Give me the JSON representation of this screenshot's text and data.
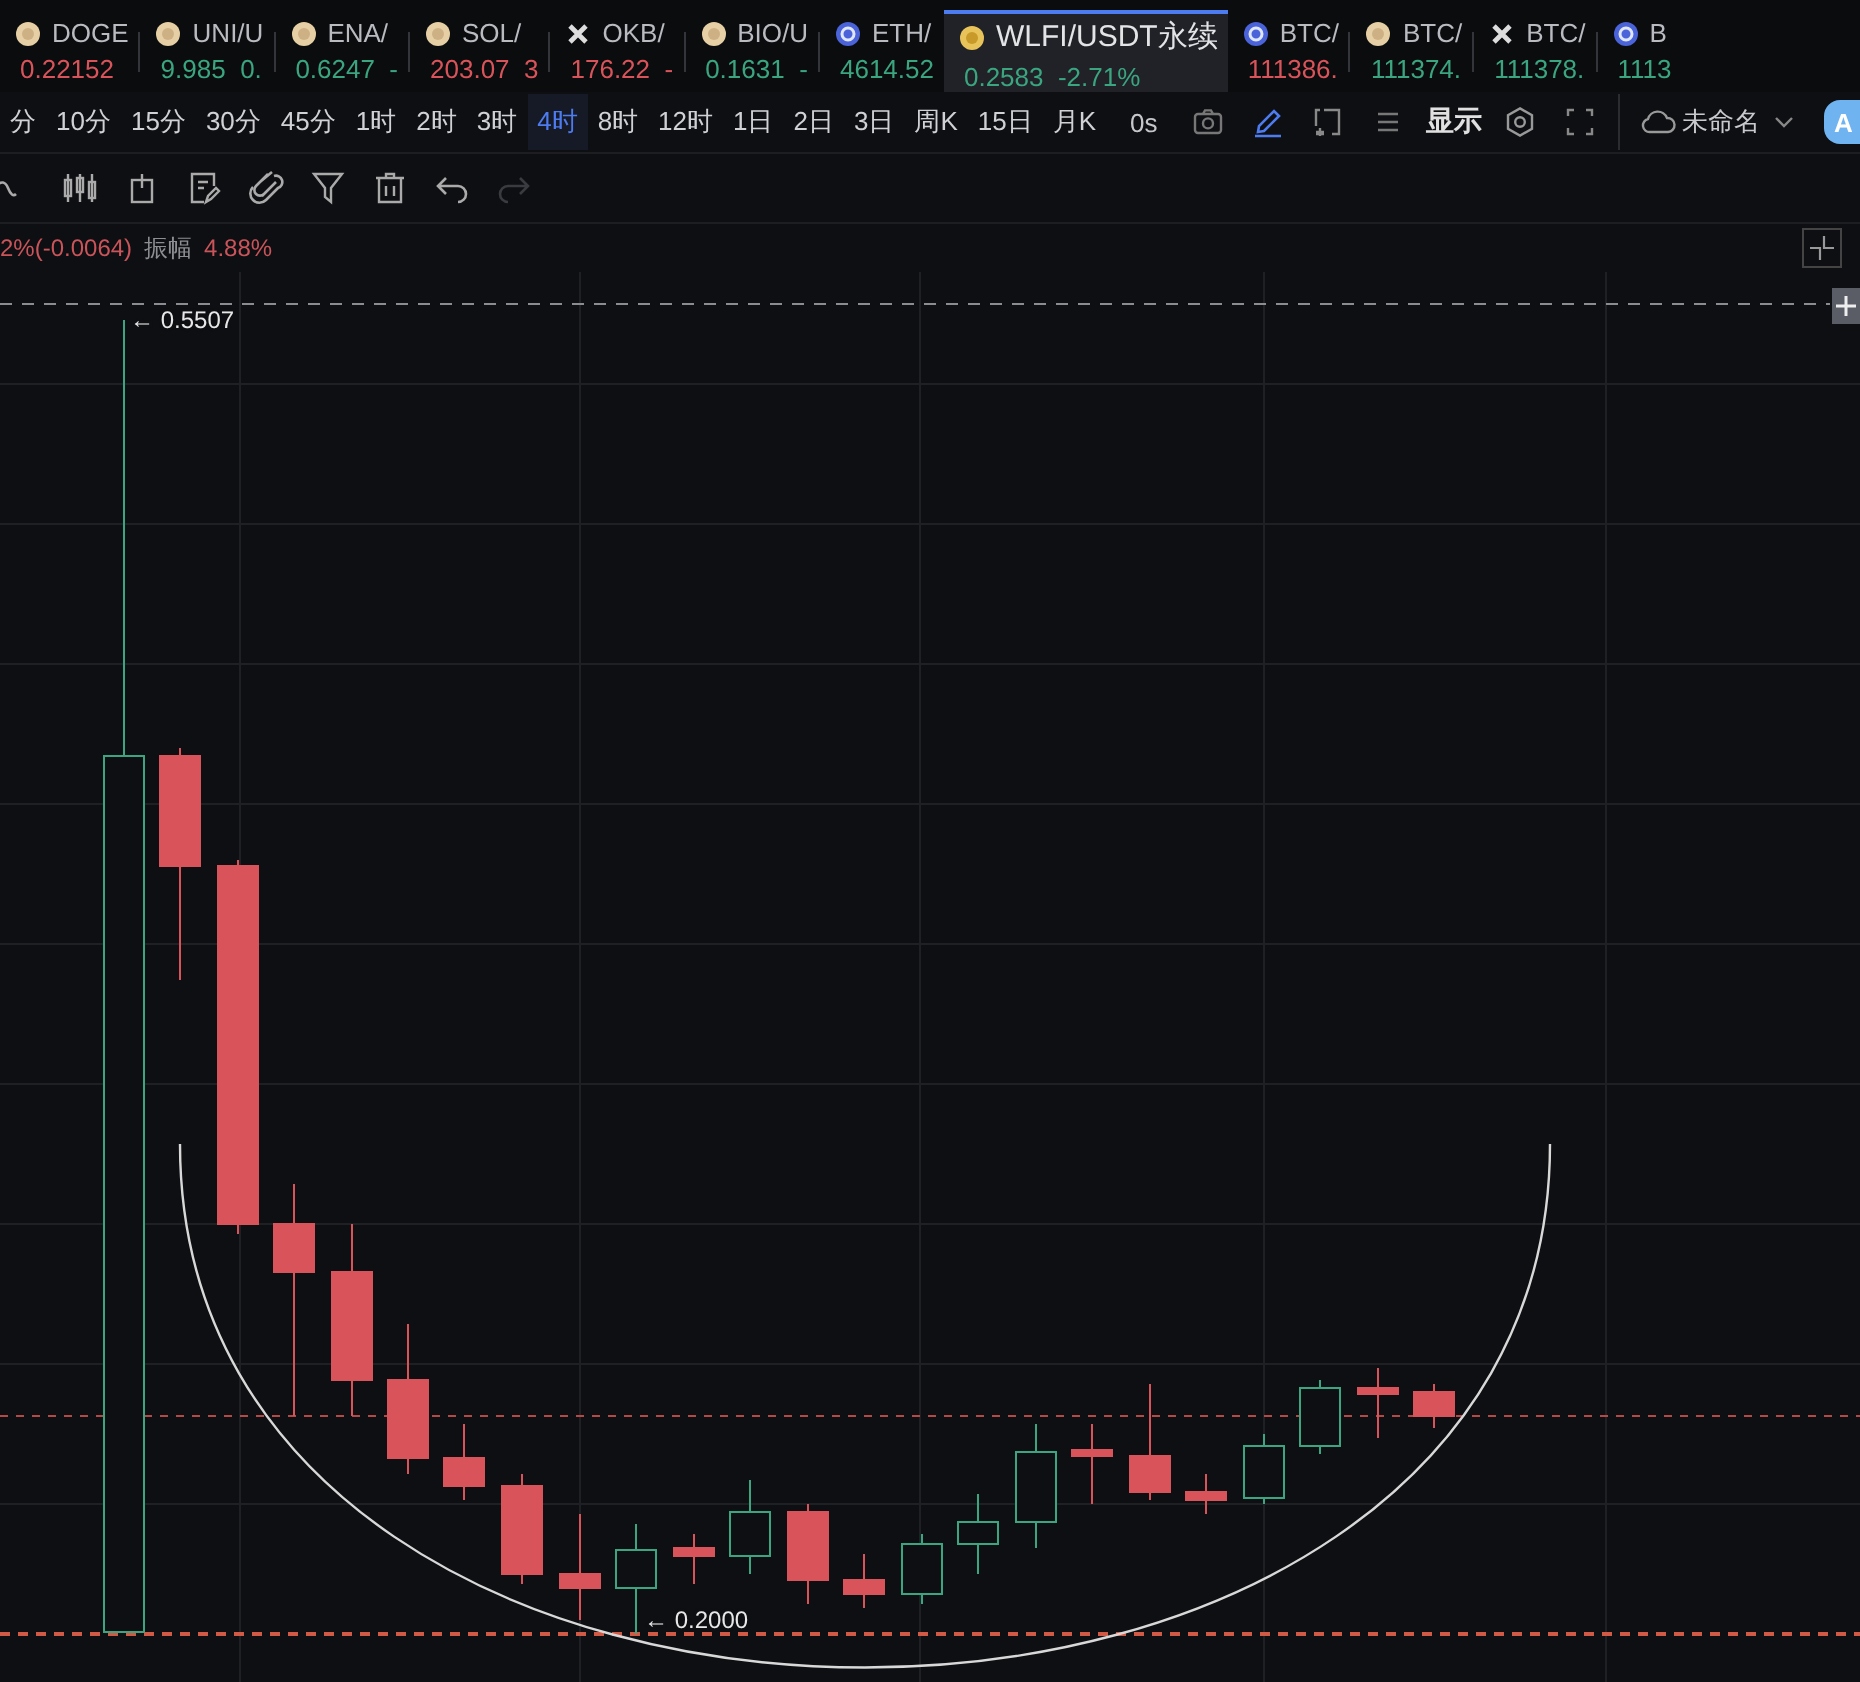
{
  "tickers": [
    {
      "symbol": "DOGE",
      "price": "0.22152",
      "color": "#d9545a",
      "kind": "coin",
      "selected": false
    },
    {
      "symbol": "UNI/U",
      "price": "9.985",
      "change": "0.",
      "color": "#3aa57f",
      "kind": "coin",
      "selected": false
    },
    {
      "symbol": "ENA/",
      "price": "0.6247",
      "change": "-",
      "color": "#3aa57f",
      "kind": "coin",
      "selected": false
    },
    {
      "symbol": "SOL/",
      "price": "203.07",
      "change": "3",
      "color": "#d9545a",
      "kind": "coin",
      "selected": false
    },
    {
      "symbol": "OKB/",
      "price": "176.22",
      "change": "-",
      "color": "#d9545a",
      "kind": "cross",
      "selected": false
    },
    {
      "symbol": "BIO/U",
      "price": "0.1631",
      "change": "-",
      "color": "#3aa57f",
      "kind": "coin",
      "selected": false
    },
    {
      "symbol": "ETH/",
      "price": "4614.52",
      "color": "#3aa57f",
      "kind": "ring",
      "selected": false
    },
    {
      "symbol": "WLFI/USDT永续",
      "price": "0.2583",
      "change": "-2.71%",
      "color": "#3aa57f",
      "kind": "coin",
      "selected": true
    },
    {
      "symbol": "BTC/",
      "price": "111386.",
      "color": "#d9545a",
      "kind": "ring",
      "selected": false
    },
    {
      "symbol": "BTC/",
      "price": "111374.",
      "color": "#3aa57f",
      "kind": "coin",
      "selected": false
    },
    {
      "symbol": "BTC/",
      "price": "111378.",
      "color": "#3aa57f",
      "kind": "cross",
      "selected": false
    },
    {
      "symbol": "B",
      "price": "1113",
      "color": "#3aa57f",
      "kind": "ring",
      "selected": false
    }
  ],
  "timeframes": [
    {
      "label": "分",
      "selected": false
    },
    {
      "label": "10分",
      "selected": false
    },
    {
      "label": "15分",
      "selected": false
    },
    {
      "label": "30分",
      "selected": false
    },
    {
      "label": "45分",
      "selected": false
    },
    {
      "label": "1时",
      "selected": false
    },
    {
      "label": "2时",
      "selected": false
    },
    {
      "label": "3时",
      "selected": false
    },
    {
      "label": "4时",
      "selected": true
    },
    {
      "label": "8时",
      "selected": false
    },
    {
      "label": "12时",
      "selected": false
    },
    {
      "label": "1日",
      "selected": false
    },
    {
      "label": "2日",
      "selected": false
    },
    {
      "label": "3日",
      "selected": false
    },
    {
      "label": "周K",
      "selected": false
    },
    {
      "label": "15日",
      "selected": false
    },
    {
      "label": "月K",
      "selected": false
    }
  ],
  "chart_toolbar": {
    "countdown": "0s",
    "draw_mode_on": true,
    "display_label": "显示",
    "layout_name": "未命名",
    "account_button": "A"
  },
  "drawing_tools": {
    "redo_disabled": true
  },
  "info": {
    "change": "2%(-0.0064)",
    "amplitude_label": "振幅",
    "amplitude": "4.88%"
  },
  "chart": {
    "high_label": "← 0.5507",
    "low_label": "← 0.2000"
  }
}
